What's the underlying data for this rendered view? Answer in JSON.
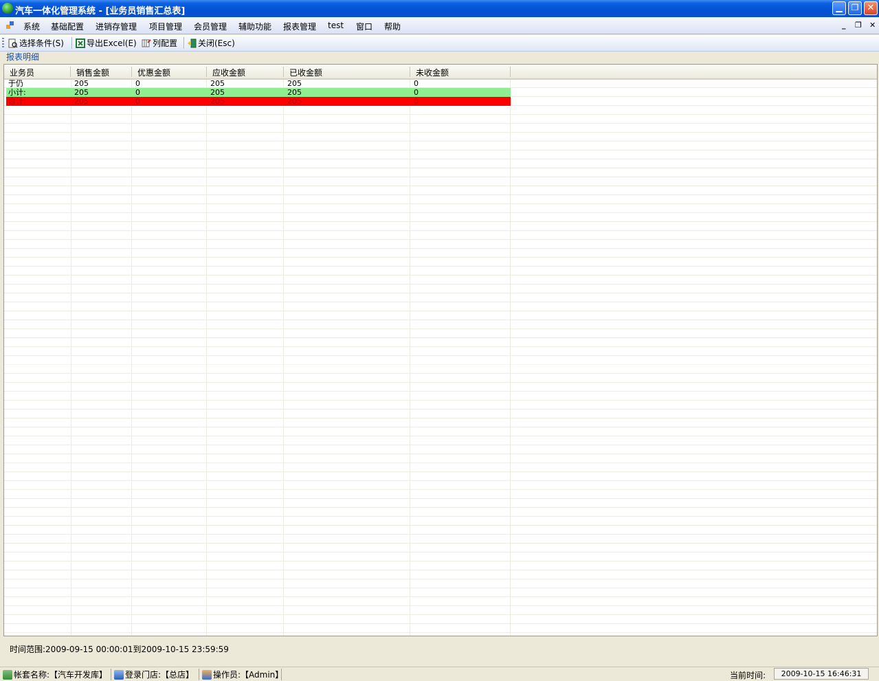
{
  "window": {
    "title": "汽车一体化管理系统 - [业务员销售汇总表]"
  },
  "menu": {
    "items": [
      "系统",
      "基础配置",
      "进销存管理",
      "项目管理",
      "会员管理",
      "辅助功能",
      "报表管理",
      "test",
      "窗口",
      "帮助"
    ]
  },
  "toolbar": {
    "select_condition": "选择条件(S)",
    "export_excel": "导出Excel(E)",
    "column_config": "列配置",
    "close": "关闭(Esc)"
  },
  "section_label": "报表明细",
  "grid": {
    "columns": [
      "业务员",
      "销售金额",
      "优惠金额",
      "应收金额",
      "已收金额",
      "未收金额"
    ],
    "rows": [
      [
        "于仍",
        "205",
        "0",
        "205",
        "205",
        "0"
      ]
    ],
    "subtotal": [
      "小计:",
      "205",
      "0",
      "205",
      "205",
      "0"
    ],
    "total": [
      "合计:",
      "205",
      "0",
      "205",
      "205",
      "0"
    ]
  },
  "range_text": "时间范围:2009-09-15 00:00:01到2009-10-15 23:59:59",
  "status": {
    "account": "帐套名称:【汽车开发库】",
    "store": "登录门店:【总店】",
    "operator": "操作员:【Admin】",
    "time_label": "当前时间:",
    "time_value": "2009-10-15 16:46:31"
  },
  "colors": {
    "subtotal_row": "#90ee90",
    "total_row": "#ff0000",
    "title_bar": "#0351d6"
  }
}
